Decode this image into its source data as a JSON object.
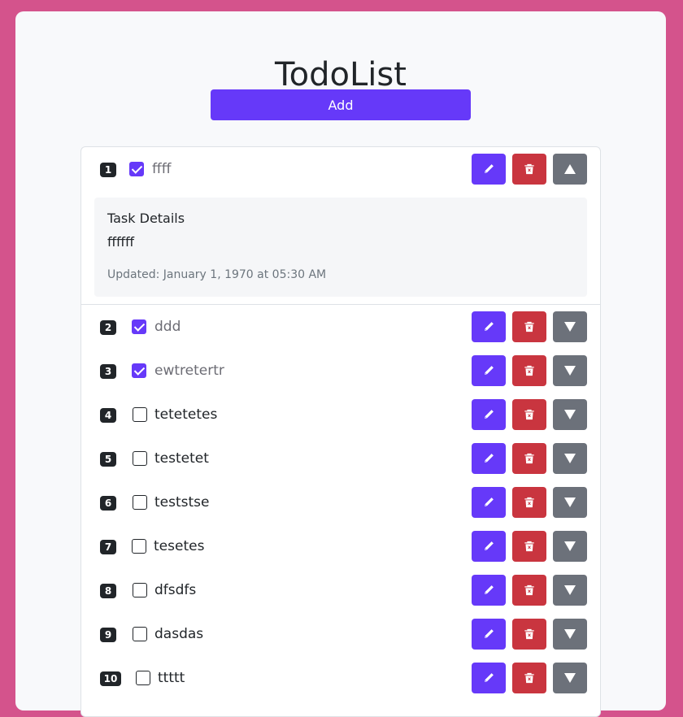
{
  "app": {
    "title": "TodoList",
    "add_label": "Add"
  },
  "colors": {
    "background": "#d4538c",
    "primary": "#6639f9",
    "danger": "#c9353f",
    "secondary": "#6c717a"
  },
  "icons": {
    "edit": "pencil-icon",
    "delete": "trash-icon",
    "collapse": "triangle-up-icon",
    "expand": "triangle-down-icon"
  },
  "todos": [
    {
      "number": "1",
      "text": "ffff",
      "done": true,
      "expanded": true
    },
    {
      "number": "2",
      "text": "ddd",
      "done": true,
      "expanded": false
    },
    {
      "number": "3",
      "text": "ewtretertr",
      "done": true,
      "expanded": false
    },
    {
      "number": "4",
      "text": "tetetetes",
      "done": false,
      "expanded": false
    },
    {
      "number": "5",
      "text": "testetet",
      "done": false,
      "expanded": false
    },
    {
      "number": "6",
      "text": "teststse",
      "done": false,
      "expanded": false
    },
    {
      "number": "7",
      "text": "tesetes",
      "done": false,
      "expanded": false
    },
    {
      "number": "8",
      "text": "dfsdfs",
      "done": false,
      "expanded": false
    },
    {
      "number": "9",
      "text": "dasdas",
      "done": false,
      "expanded": false
    },
    {
      "number": "10",
      "text": "ttttt",
      "done": false,
      "expanded": false
    }
  ],
  "details": {
    "heading": "Task Details",
    "description": "ffffff",
    "updated": "Updated: January 1, 1970 at 05:30 AM"
  }
}
